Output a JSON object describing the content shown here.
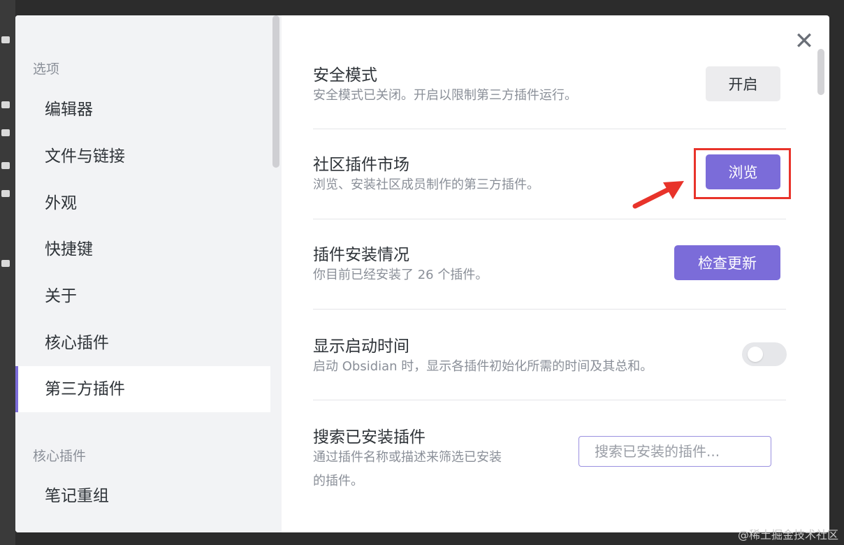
{
  "sidebar": {
    "heading_options": "选项",
    "items": [
      {
        "label": "编辑器"
      },
      {
        "label": "文件与链接"
      },
      {
        "label": "外观"
      },
      {
        "label": "快捷键"
      },
      {
        "label": "关于"
      },
      {
        "label": "核心插件"
      },
      {
        "label": "第三方插件",
        "active": true
      }
    ],
    "heading_core": "核心插件",
    "items2": [
      {
        "label": "笔记重组"
      }
    ]
  },
  "settings": {
    "safe_mode": {
      "title": "安全模式",
      "desc": "安全模式已关闭。开启以限制第三方插件运行。",
      "button": "开启"
    },
    "community": {
      "title": "社区插件市场",
      "desc": "浏览、安装社区成员制作的第三方插件。",
      "button": "浏览"
    },
    "installed": {
      "title": "插件安装情况",
      "desc": "你目前已经安装了 26 个插件。",
      "button": "检查更新"
    },
    "startup": {
      "title": "显示启动时间",
      "desc": "启动 Obsidian 时，显示各插件初始化所需的时间及其总和。",
      "toggle_on": false
    },
    "search": {
      "title": "搜索已安装插件",
      "desc_line1": "通过插件名称或描述来筛选已安装",
      "desc_line2": "的插件。",
      "placeholder": "搜索已安装的插件..."
    }
  },
  "close_glyph": "✕",
  "watermark": "@稀土掘金技术社区",
  "colors": {
    "accent": "#7b6cd9",
    "highlight": "#e8332a"
  }
}
